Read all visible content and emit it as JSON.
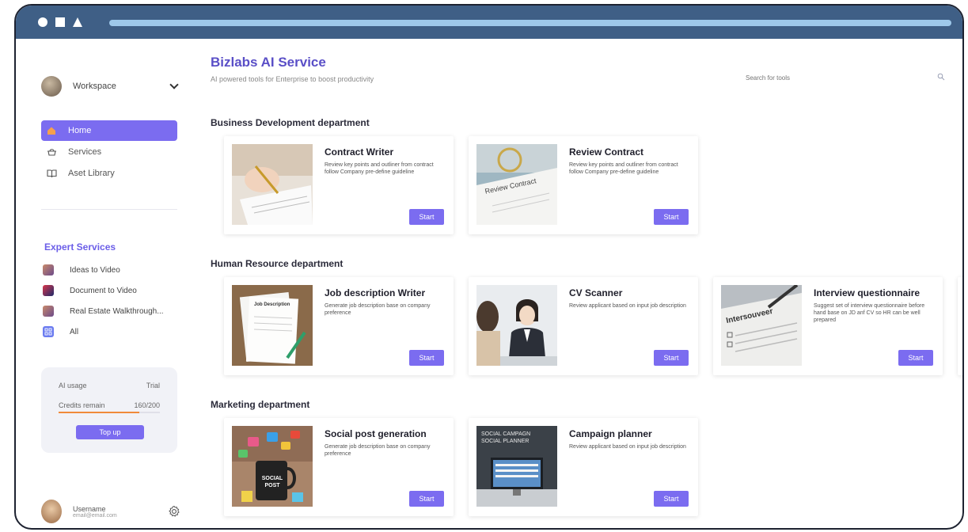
{
  "colors": {
    "accent": "#7b6cf0",
    "title": "#5a4fc7",
    "titlebar": "#3f5f86",
    "usage_fill": "#f08a3a"
  },
  "sidebar": {
    "workspace": {
      "label": "Workspace",
      "icon": "chevron-down-icon"
    },
    "nav": [
      {
        "label": "Home",
        "icon": "home-icon",
        "active": true
      },
      {
        "label": "Services",
        "icon": "services-icon",
        "active": false
      },
      {
        "label": "Aset Library",
        "icon": "book-icon",
        "active": false
      }
    ],
    "expert": {
      "title": "Expert Services",
      "items": [
        {
          "label": "Ideas to Video"
        },
        {
          "label": "Document to Video"
        },
        {
          "label": "Real Estate Walkthrough..."
        },
        {
          "label": "All"
        }
      ]
    },
    "usage": {
      "label": "AI usage",
      "plan": "Trial",
      "credits_label": "Credits remain",
      "credits_value": "160/200",
      "credits_fraction": 0.8,
      "topup_label": "Top up"
    },
    "user": {
      "name": "Username",
      "email": "email@email.com"
    }
  },
  "header": {
    "title": "Bizlabs AI Service",
    "subtitle": "AI powered tools for Enterprise to boost productivity",
    "search_placeholder": "Search for tools"
  },
  "sections": [
    {
      "title": "Business Development department",
      "cards": [
        {
          "title": "Contract Writer",
          "desc": "Review key points and outliner from contract follow Company pre-define guideline",
          "button": "Start"
        },
        {
          "title": "Review Contract",
          "desc": "Review key points and outliner from contract follow Company pre-define guideline",
          "button": "Start",
          "image_text": "Review Contract"
        }
      ]
    },
    {
      "title": "Human Resource department",
      "cards": [
        {
          "title": "Job description Writer",
          "desc": "Generate job description base on company preference",
          "button": "Start",
          "image_text": "Job Description"
        },
        {
          "title": "CV Scanner",
          "desc": "Review applicant based on input job description",
          "button": "Start"
        },
        {
          "title": "Interview questionnaire",
          "desc": "Suggest set of interview questionnaire before hand base on JD anf CV so HR can be well prepared",
          "button": "Start",
          "image_text": "Intersouveer"
        }
      ]
    },
    {
      "title": "Marketing department",
      "cards": [
        {
          "title": "Social post generation",
          "desc": "Generate job description base on company preference",
          "button": "Start",
          "image_text": "SOCIAL POST"
        },
        {
          "title": "Campaign planner",
          "desc": "Review applicant based on input job description",
          "button": "Start",
          "image_text": "SOCIAL CAMPAGN SOCIAL PLANNER"
        }
      ]
    }
  ]
}
